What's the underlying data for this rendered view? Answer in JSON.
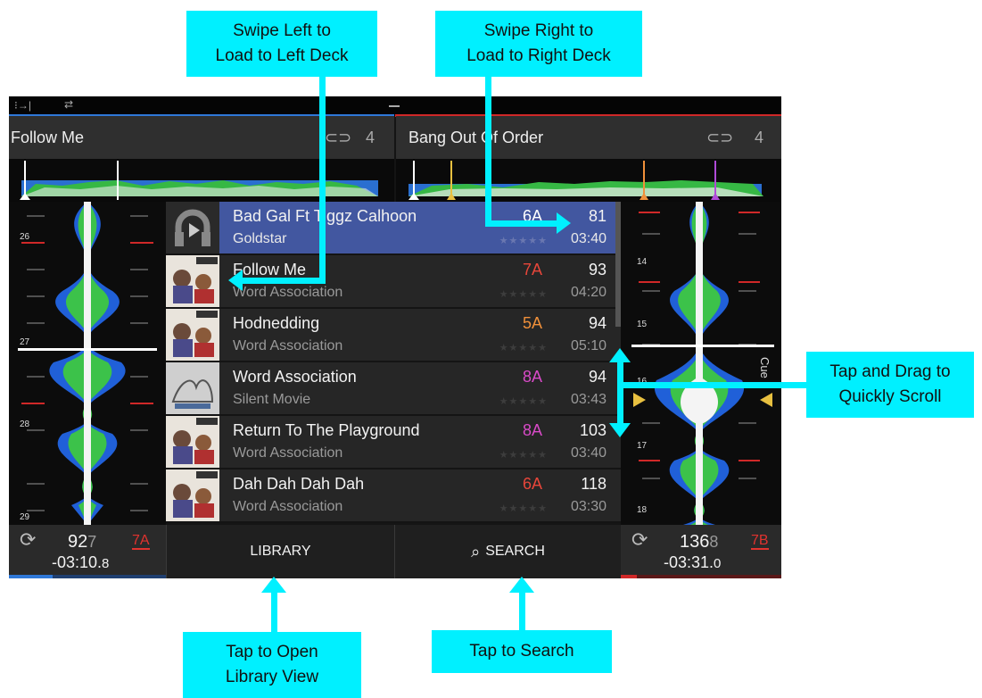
{
  "callouts": {
    "swipe_left": [
      "Swipe Left to",
      "Load to Left Deck"
    ],
    "swipe_right": [
      "Swipe Right to",
      "Load to Right Deck"
    ],
    "tap_drag": [
      "Tap and Drag to",
      "Quickly Scroll"
    ],
    "tap_library": [
      "Tap to Open",
      "Library View"
    ],
    "tap_search": "Tap to Search"
  },
  "decks": {
    "left": {
      "title": "Follow Me",
      "loop": "4",
      "bpm_main": "92",
      "bpm_fraction": "7",
      "key": "7A",
      "remaining_main": "-03:10.",
      "remaining_fraction": "8",
      "accent": "#2f78d8",
      "beat_markers": [
        "26",
        "27",
        "28",
        "29"
      ]
    },
    "right": {
      "title": "Bang Out Of Order",
      "loop": "4",
      "bpm_main": "136",
      "bpm_fraction": "8",
      "key": "7B",
      "remaining_main": "-03:31.",
      "remaining_fraction": "0",
      "accent": "#d02828",
      "beat_markers": [
        "14",
        "15",
        "16",
        "17",
        "18"
      ],
      "cue_label": "Cue"
    }
  },
  "tracks": [
    {
      "title": "Bad Gal Ft Tiggz Calhoon",
      "artist": "Goldstar",
      "key": "6A",
      "key_color": "#ffffff",
      "bpm": "81",
      "time": "03:40",
      "rating": "★★★★★",
      "art": "headphones-icon",
      "selected": true
    },
    {
      "title": "Follow Me",
      "artist": "Word Association",
      "key": "7A",
      "key_color": "#e8463a",
      "bpm": "93",
      "time": "04:20",
      "rating": "★★★★★",
      "art": "album-art-word"
    },
    {
      "title": "Hodnedding",
      "artist": "Word Association",
      "key": "5A",
      "key_color": "#f0903a",
      "bpm": "94",
      "time": "05:10",
      "rating": "★★★★★",
      "art": "album-art-word"
    },
    {
      "title": "Word Association",
      "artist": "Silent Movie",
      "key": "8A",
      "key_color": "#d94ac8",
      "bpm": "94",
      "time": "03:43",
      "rating": "★★★★★",
      "art": "album-art-sketch"
    },
    {
      "title": "Return To The Playground",
      "artist": "Word Association",
      "key": "8A",
      "key_color": "#d94ac8",
      "bpm": "103",
      "time": "03:40",
      "rating": "★★★★★",
      "art": "album-art-word"
    },
    {
      "title": "Dah Dah Dah Dah",
      "artist": "Word Association",
      "key": "6A",
      "key_color": "#e8463a",
      "bpm": "118",
      "time": "03:30",
      "rating": "★★★★★",
      "art": "album-art-word"
    }
  ],
  "buttons": {
    "library": "LIBRARY",
    "search": "SEARCH"
  },
  "colors": {
    "callout": "#00f0ff",
    "selected_row": "#4257a0",
    "wave_green": "#3cc24a",
    "wave_blue": "#2060d8"
  }
}
